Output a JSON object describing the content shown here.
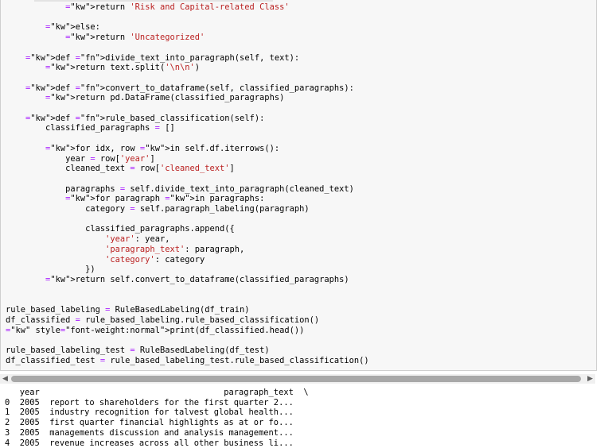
{
  "code_lines": [
    "            return 'Risk and Capital-related Class'",
    "",
    "        else:",
    "            return 'Uncategorized'",
    "",
    "    def divide_text_into_paragraph(self, text):",
    "        return text.split('\\n\\n')",
    "",
    "    def convert_to_dataframe(self, classified_paragraphs):",
    "        return pd.DataFrame(classified_paragraphs)",
    "",
    "    def rule_based_classification(self):",
    "        classified_paragraphs = []",
    "",
    "        for idx, row in self.df.iterrows():",
    "            year = row['year']",
    "            cleaned_text = row['cleaned_text']",
    "",
    "            paragraphs = self.divide_text_into_paragraph(cleaned_text)",
    "            for paragraph in paragraphs:",
    "                category = self.paragraph_labeling(paragraph)",
    "",
    "                classified_paragraphs.append({",
    "                    'year': year,",
    "                    'paragraph_text': paragraph,",
    "                    'category': category",
    "                })",
    "        return self.convert_to_dataframe(classified_paragraphs)",
    "",
    "",
    "rule_based_labeling = RuleBasedLabeling(df_train)",
    "df_classified = rule_based_labeling.rule_based_classification()",
    "print(df_classified.head())",
    "",
    "rule_based_labeling_test = RuleBasedLabeling(df_test)",
    "df_classified_test = rule_based_labeling_test.rule_based_classification()"
  ],
  "output": {
    "header": "   year                                     paragraph_text  \\",
    "rows": [
      "0  2005  report to shareholders for the first quarter 2...",
      "1  2005  industry recognition for talvest global health...",
      "2  2005  first quarter financial highlights as at or fo...",
      "3  2005  managements discussion and analysis management...",
      "4  2005  revenue increases across all other business li..."
    ]
  },
  "scrollbar": {
    "left_arrow": "◀",
    "right_arrow": "▶"
  }
}
